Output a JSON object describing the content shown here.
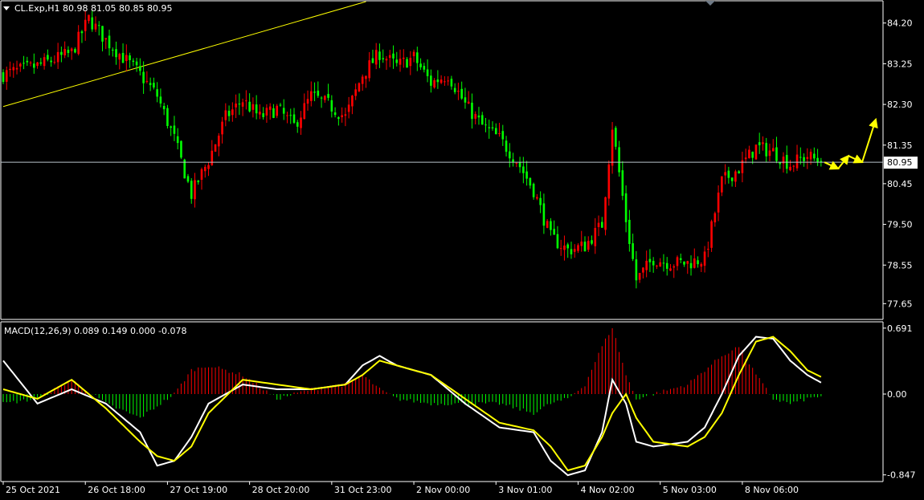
{
  "chart_data": [
    {
      "type": "candlestick",
      "title": "CL.Exp,H1  80.98 81.05 80.85 80.95",
      "symbol": "CL.Exp",
      "timeframe": "H1",
      "ohlc_last": {
        "open": 80.98,
        "high": 81.05,
        "low": 80.85,
        "close": 80.95
      },
      "current_price_label": "80.95",
      "current_price": 80.95,
      "y_ticks": [
        "84.20",
        "83.25",
        "82.30",
        "81.35",
        "80.45",
        "79.50",
        "78.55",
        "77.65"
      ],
      "ylim": [
        77.3,
        84.7
      ],
      "x_ticks": [
        "25 Oct 2021",
        "26 Oct 18:00",
        "27 Oct 19:00",
        "28 Oct 20:00",
        "31 Oct 23:00",
        "2 Nov 00:00",
        "3 Nov 01:00",
        "4 Nov 02:00",
        "5 Nov 03:00",
        "8 Nov 06:00"
      ],
      "bull_color": "#ff0000",
      "bear_color": "#00ff00",
      "trendline_color": "#ffff00",
      "close_path": [
        [
          0,
          83.0
        ],
        [
          10,
          83.2
        ],
        [
          20,
          83.5
        ],
        [
          25,
          84.3
        ],
        [
          30,
          83.8
        ],
        [
          40,
          83.0
        ],
        [
          45,
          82.5
        ],
        [
          50,
          81.5
        ],
        [
          55,
          80.2
        ],
        [
          60,
          81.0
        ],
        [
          65,
          82.0
        ],
        [
          70,
          82.4
        ],
        [
          75,
          82.0
        ],
        [
          80,
          82.2
        ],
        [
          85,
          81.8
        ],
        [
          90,
          82.5
        ],
        [
          95,
          82.3
        ],
        [
          100,
          82.0
        ],
        [
          105,
          83.0
        ],
        [
          110,
          83.5
        ],
        [
          115,
          83.2
        ],
        [
          120,
          83.4
        ],
        [
          125,
          82.8
        ],
        [
          130,
          83.0
        ],
        [
          135,
          82.3
        ],
        [
          140,
          81.8
        ],
        [
          145,
          81.5
        ],
        [
          150,
          81.0
        ],
        [
          155,
          80.3
        ],
        [
          160,
          79.2
        ],
        [
          165,
          78.9
        ],
        [
          170,
          79.0
        ],
        [
          175,
          79.5
        ],
        [
          178,
          81.8
        ],
        [
          182,
          79.6
        ],
        [
          185,
          78.2
        ],
        [
          190,
          78.7
        ],
        [
          195,
          78.6
        ],
        [
          200,
          78.6
        ],
        [
          205,
          78.7
        ],
        [
          210,
          80.5
        ],
        [
          215,
          80.8
        ],
        [
          220,
          81.3
        ],
        [
          225,
          81.2
        ],
        [
          230,
          80.9
        ],
        [
          235,
          81.1
        ],
        [
          239,
          80.95
        ]
      ],
      "trendline": {
        "start": [
          0,
          82.25
        ],
        "end": [
          106,
          84.7
        ]
      },
      "forecast_arrows": [
        [
          240,
          80.95
        ],
        [
          244,
          80.8
        ],
        [
          247,
          81.1
        ],
        [
          251,
          80.95
        ],
        [
          255,
          81.95
        ]
      ]
    },
    {
      "type": "line",
      "title": "MACD(12,26,9) 0.089 0.149 0.000 -0.078",
      "indicator": "MACD",
      "params": [
        12,
        26,
        9
      ],
      "values_label": "0.089 0.149 0.000 -0.078",
      "y_ticks": [
        "0.691",
        "0.00",
        "-0.847"
      ],
      "ylim": [
        -0.9,
        0.74
      ],
      "histogram_pos_color": "#ff0000",
      "histogram_neg_color": "#00ff00",
      "series": [
        {
          "color": "#ffffff",
          "values": [
            [
              0,
              0.35
            ],
            [
              10,
              -0.1
            ],
            [
              20,
              0.05
            ],
            [
              30,
              -0.1
            ],
            [
              40,
              -0.4
            ],
            [
              45,
              -0.75
            ],
            [
              50,
              -0.7
            ],
            [
              55,
              -0.45
            ],
            [
              60,
              -0.1
            ],
            [
              70,
              0.1
            ],
            [
              80,
              0.05
            ],
            [
              90,
              0.05
            ],
            [
              100,
              0.1
            ],
            [
              105,
              0.3
            ],
            [
              110,
              0.4
            ],
            [
              115,
              0.3
            ],
            [
              125,
              0.2
            ],
            [
              135,
              -0.1
            ],
            [
              145,
              -0.35
            ],
            [
              155,
              -0.4
            ],
            [
              160,
              -0.7
            ],
            [
              165,
              -0.85
            ],
            [
              170,
              -0.8
            ],
            [
              175,
              -0.4
            ],
            [
              178,
              0.15
            ],
            [
              182,
              -0.1
            ],
            [
              185,
              -0.5
            ],
            [
              190,
              -0.55
            ],
            [
              200,
              -0.5
            ],
            [
              205,
              -0.35
            ],
            [
              210,
              0.0
            ],
            [
              215,
              0.4
            ],
            [
              220,
              0.6
            ],
            [
              225,
              0.58
            ],
            [
              230,
              0.35
            ],
            [
              235,
              0.2
            ],
            [
              239,
              0.12
            ]
          ]
        },
        {
          "color": "#ffff00",
          "values": [
            [
              0,
              0.05
            ],
            [
              10,
              -0.05
            ],
            [
              20,
              0.15
            ],
            [
              30,
              -0.15
            ],
            [
              40,
              -0.5
            ],
            [
              45,
              -0.65
            ],
            [
              50,
              -0.7
            ],
            [
              55,
              -0.55
            ],
            [
              60,
              -0.2
            ],
            [
              70,
              0.15
            ],
            [
              80,
              0.1
            ],
            [
              90,
              0.05
            ],
            [
              100,
              0.1
            ],
            [
              105,
              0.2
            ],
            [
              110,
              0.35
            ],
            [
              115,
              0.3
            ],
            [
              125,
              0.2
            ],
            [
              135,
              -0.05
            ],
            [
              145,
              -0.3
            ],
            [
              155,
              -0.38
            ],
            [
              160,
              -0.55
            ],
            [
              165,
              -0.8
            ],
            [
              170,
              -0.75
            ],
            [
              175,
              -0.45
            ],
            [
              178,
              -0.2
            ],
            [
              182,
              0.0
            ],
            [
              185,
              -0.25
            ],
            [
              190,
              -0.5
            ],
            [
              200,
              -0.55
            ],
            [
              205,
              -0.45
            ],
            [
              210,
              -0.2
            ],
            [
              215,
              0.2
            ],
            [
              220,
              0.55
            ],
            [
              225,
              0.6
            ],
            [
              230,
              0.45
            ],
            [
              235,
              0.25
            ],
            [
              239,
              0.18
            ]
          ]
        }
      ],
      "histogram": [
        [
          0,
          -0.1
        ],
        [
          10,
          -0.05
        ],
        [
          20,
          0.15
        ],
        [
          30,
          -0.1
        ],
        [
          40,
          -0.25
        ],
        [
          50,
          0.0
        ],
        [
          55,
          0.25
        ],
        [
          60,
          0.3
        ],
        [
          70,
          0.2
        ],
        [
          80,
          -0.05
        ],
        [
          90,
          0.05
        ],
        [
          100,
          0.1
        ],
        [
          105,
          0.2
        ],
        [
          110,
          0.05
        ],
        [
          115,
          -0.05
        ],
        [
          125,
          -0.1
        ],
        [
          135,
          -0.1
        ],
        [
          145,
          -0.1
        ],
        [
          155,
          -0.2
        ],
        [
          160,
          -0.1
        ],
        [
          165,
          -0.05
        ],
        [
          170,
          0.1
        ],
        [
          175,
          0.5
        ],
        [
          178,
          0.7
        ],
        [
          182,
          0.2
        ],
        [
          185,
          -0.05
        ],
        [
          190,
          0.0
        ],
        [
          200,
          0.1
        ],
        [
          205,
          0.25
        ],
        [
          210,
          0.4
        ],
        [
          215,
          0.5
        ],
        [
          220,
          0.2
        ],
        [
          225,
          -0.05
        ],
        [
          230,
          -0.1
        ],
        [
          235,
          -0.05
        ],
        [
          239,
          -0.02
        ]
      ]
    }
  ]
}
